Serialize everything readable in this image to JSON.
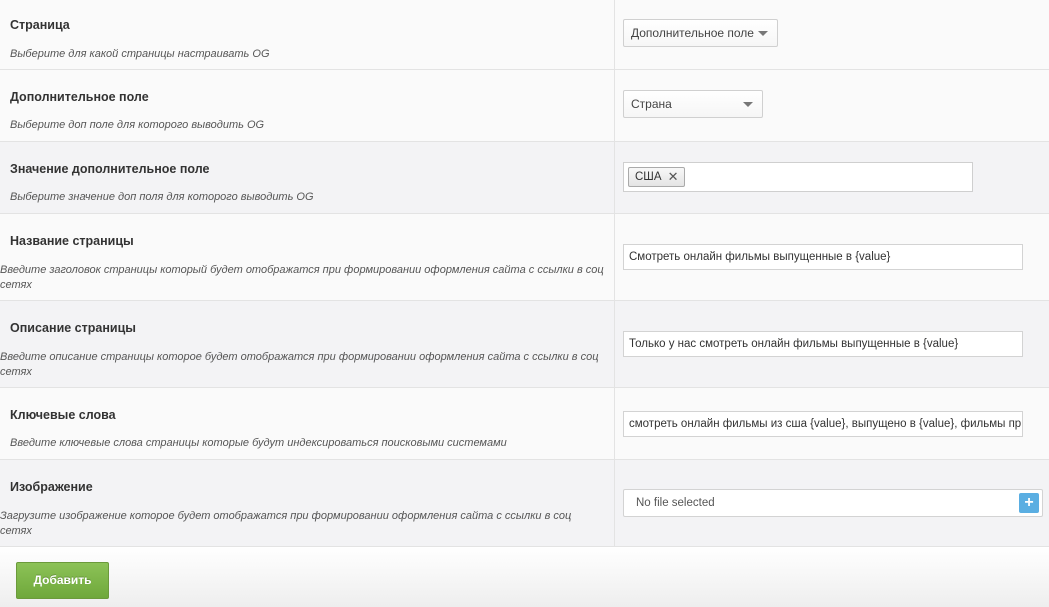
{
  "rows": [
    {
      "title": "Страница",
      "desc": "Выберите для какой страницы настраивать OG",
      "control": {
        "type": "select",
        "value": "Дополнительное поле"
      }
    },
    {
      "title": "Дополнительное поле",
      "desc": "Выберите доп поле для которого выводить OG",
      "control": {
        "type": "select",
        "value": "Страна"
      }
    },
    {
      "title": "Значение дополнительное поле",
      "desc": "Выберите значение доп поля для которого выводить OG",
      "control": {
        "type": "tags",
        "tags": [
          "США"
        ],
        "remove_glyph": "✕"
      }
    },
    {
      "title": "Название страницы",
      "desc": "Введите заголовок страницы который будет отображатся при формировании оформления сайта с ссылки в соц сетях",
      "control": {
        "type": "text",
        "value": "Смотреть онлайн фильмы выпущенные в {value}"
      }
    },
    {
      "title": "Описание страницы",
      "desc": "Введите описание страницы которое будет отображатся при формировании оформления сайта с ссылки в соц сетях",
      "control": {
        "type": "text",
        "value": "Только у нас смотреть онлайн фильмы выпущенные в {value}"
      }
    },
    {
      "title": "Ключевые слова",
      "desc": "Введите ключевые слова страницы которые будут индексироваться поисковыми системами",
      "control": {
        "type": "text",
        "value": "смотреть онлайн фильмы из сша {value}, выпущено в {value}, фильмы пр"
      }
    },
    {
      "title": "Изображение",
      "desc": "Загрузите изображение которое будет отображатся при формировании оформления сайта с ссылки в соц сетях",
      "control": {
        "type": "file",
        "placeholder": "No file selected",
        "button_glyph": "+"
      }
    }
  ],
  "footer": {
    "add_button": "Добавить"
  },
  "colors": {
    "accent_green": "#7ab648",
    "file_button_blue": "#5aaee2"
  }
}
